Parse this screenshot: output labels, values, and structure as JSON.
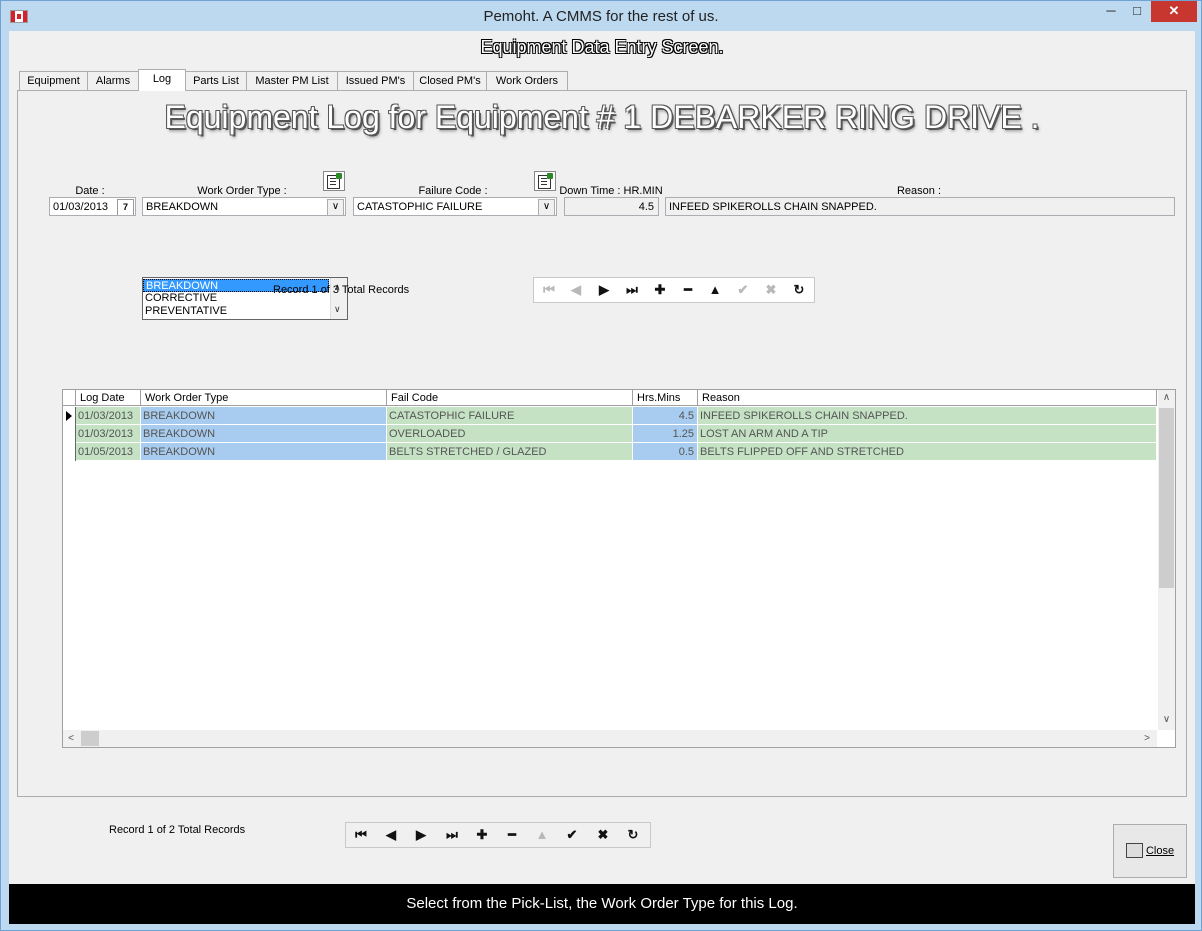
{
  "window": {
    "title": "Pemoht.  A CMMS for the rest of us.",
    "min_glyph": "─",
    "max_glyph": "□",
    "close_glyph": "✕"
  },
  "screen_title": "Equipment Data Entry Screen.",
  "tabs": [
    {
      "label": "Equipment"
    },
    {
      "label": "Alarms"
    },
    {
      "label": "Log",
      "active": true
    },
    {
      "label": "Parts List"
    },
    {
      "label": "Master PM List"
    },
    {
      "label": "Issued PM's"
    },
    {
      "label": "Closed PM's"
    },
    {
      "label": "Work Orders"
    }
  ],
  "log": {
    "heading": "Equipment Log for Equipment # 1 DEBARKER RING DRIVE .",
    "labels": {
      "date": "Date :",
      "work_order_type": "Work Order Type :",
      "failure_code": "Failure Code :",
      "down_time": "Down Time : HR.MIN",
      "reason": "Reason :"
    },
    "values": {
      "date": "01/03/2013",
      "work_order_type": "BREAKDOWN",
      "failure_code": "CATASTOPHIC FAILURE",
      "down_time": "4.5",
      "reason": "INFEED SPIKEROLLS CHAIN SNAPPED."
    },
    "calendar_glyph": "7",
    "dropdown_arrow": "∨",
    "dropdown_options": [
      "BREAKDOWN",
      "CORRECTIVE",
      "PREVENTATIVE"
    ],
    "dropdown_selected": "BREAKDOWN",
    "record_info": "Record 1 of 3 Total Records"
  },
  "grid": {
    "columns": [
      "Log Date",
      "Work Order Type",
      "Fail Code",
      "Hrs.Mins",
      "Reason"
    ],
    "rows": [
      {
        "date": "01/03/2013",
        "type": "BREAKDOWN",
        "fail": "CATASTOPHIC FAILURE",
        "hrs": "4.5",
        "reason": "INFEED SPIKEROLLS CHAIN SNAPPED."
      },
      {
        "date": "01/03/2013",
        "type": "BREAKDOWN",
        "fail": "OVERLOADED",
        "hrs": "1.25",
        "reason": "LOST AN ARM AND A TIP"
      },
      {
        "date": "01/05/2013",
        "type": "BREAKDOWN",
        "fail": "BELTS STRETCHED / GLAZED",
        "hrs": "0.5",
        "reason": "BELTS FLIPPED OFF AND STRETCHED"
      }
    ]
  },
  "nav_glyphs": {
    "first": "⏮",
    "prev": "◀",
    "next": "▶",
    "last": "⏭",
    "add": "✚",
    "delete": "━",
    "edit": "▲",
    "post": "✔",
    "cancel": "✖",
    "refresh": "↻"
  },
  "bottom": {
    "record_info": "Record 1 of 2 Total Records",
    "close_label": "Close"
  },
  "status_text": "Select from the Pick-List, the Work Order Type for this Log."
}
